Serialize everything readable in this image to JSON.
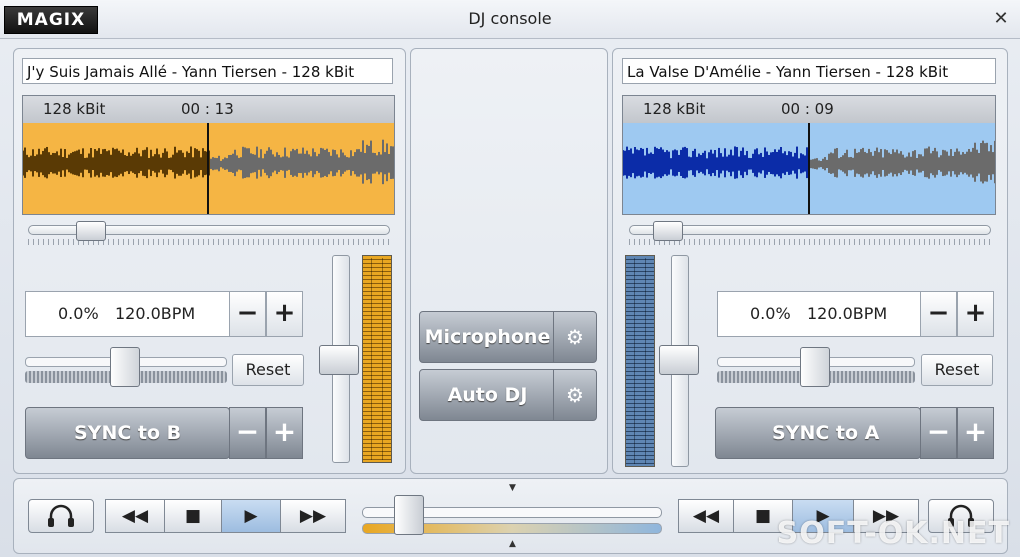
{
  "app": {
    "logo": "MAGIX",
    "title": "DJ console",
    "close": "✕"
  },
  "deckA": {
    "track": "J'y Suis Jamais Allé - Yann Tiersen - 128 kBit",
    "bitrate": "128 kBit",
    "time": "00 : 13",
    "wave_color": "#f5b544",
    "played_color": "#5a3a05",
    "position": 0.5,
    "pitch": "0.0%",
    "bpm": "120.0BPM",
    "minus": "−",
    "plus": "+",
    "reset": "Reset",
    "sync": "SYNC to B"
  },
  "deckB": {
    "track": "La Valse D'Amélie - Yann Tiersen - 128 kBit",
    "bitrate": "128 kBit",
    "time": "00 : 09",
    "wave_color": "#9ec9f1",
    "played_color": "#0b2ca8",
    "position": 0.5,
    "pitch": "0.0%",
    "bpm": "120.0BPM",
    "minus": "−",
    "plus": "+",
    "reset": "Reset",
    "sync": "SYNC to A"
  },
  "center": {
    "microphone": "Microphone",
    "autodj": "Auto DJ",
    "settings_icon": "⚙"
  },
  "transport": {
    "rewind": "◀◀",
    "stop": "■",
    "play": "▶",
    "forward": "▶▶",
    "headphones_icon": "🎧"
  },
  "watermark": "SOFT-OK.NET"
}
